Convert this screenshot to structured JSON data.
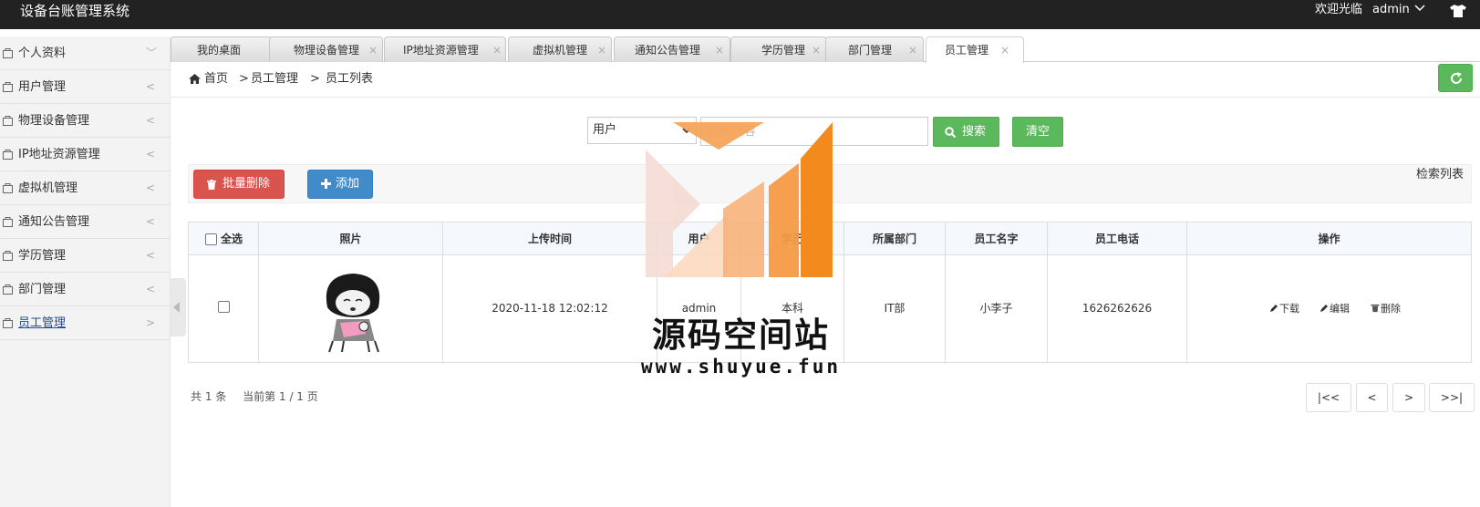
{
  "app": {
    "title": "设备台账管理系统",
    "welcome": "欢迎光临",
    "user": "admin"
  },
  "sidebar": {
    "items": [
      {
        "label": "个人资料",
        "arrow": "﹀"
      },
      {
        "label": "用户管理",
        "arrow": "<"
      },
      {
        "label": "物理设备管理",
        "arrow": "<"
      },
      {
        "label": "IP地址资源管理",
        "arrow": "<"
      },
      {
        "label": "虚拟机管理",
        "arrow": "<"
      },
      {
        "label": "通知公告管理",
        "arrow": "<"
      },
      {
        "label": "学历管理",
        "arrow": "<"
      },
      {
        "label": "部门管理",
        "arrow": "<"
      },
      {
        "label": "员工管理",
        "arrow": ">"
      }
    ]
  },
  "tabs": [
    {
      "label": "我的桌面",
      "close": ""
    },
    {
      "label": "物理设备管理",
      "close": "×"
    },
    {
      "label": "IP地址资源管理",
      "close": "×"
    },
    {
      "label": "虚拟机管理",
      "close": "×"
    },
    {
      "label": "通知公告管理",
      "close": "×"
    },
    {
      "label": "学历管理",
      "close": "×"
    },
    {
      "label": "部门管理",
      "close": "×"
    },
    {
      "label": "员工管理",
      "close": "×"
    }
  ],
  "breadcrumb": {
    "home": "首页",
    "sep": ">",
    "section": "员工管理",
    "current": "员工列表"
  },
  "search": {
    "field_selected": "用户",
    "placeholder": "检索内容",
    "search_label": "搜索",
    "clear_label": "清空"
  },
  "toolbar": {
    "batch_delete_label": "批量删除",
    "add_label": "添加",
    "right_label": "检索列表"
  },
  "table": {
    "select_all_label": "全选",
    "headers": [
      "照片",
      "上传时间",
      "用户",
      "学历",
      "所属部门",
      "员工名字",
      "员工电话",
      "操作"
    ],
    "rows": [
      {
        "upload_time": "2020-11-18 12:02:12",
        "user": "admin",
        "education": "本科",
        "department": "IT部",
        "name": "小李子",
        "phone": "1626262626",
        "actions": [
          "下载",
          "编辑",
          "删除"
        ]
      }
    ]
  },
  "footer": {
    "total_prefix": "共",
    "total_count": "1",
    "total_suffix": "条",
    "page_prefix": "当前第",
    "page_value": "1 / 1",
    "page_suffix": "页"
  },
  "pager": {
    "first": "|<<",
    "prev": "<",
    "next": ">",
    "last": ">>|"
  },
  "watermark": {
    "text": "源码空间站",
    "url": "www.shuyue.fun"
  },
  "colors": {
    "green": "#5cb85c",
    "red": "#d9534f",
    "blue": "#428bca",
    "topbar": "#222222",
    "watermark_orange": "#f58a1f"
  },
  "icons": [
    "chevron-down-icon",
    "shirt-icon",
    "bag-icon",
    "home-icon",
    "refresh-icon",
    "search-icon",
    "trash-icon",
    "plus-icon",
    "pencil-icon",
    "collapse-arrow-icon"
  ]
}
